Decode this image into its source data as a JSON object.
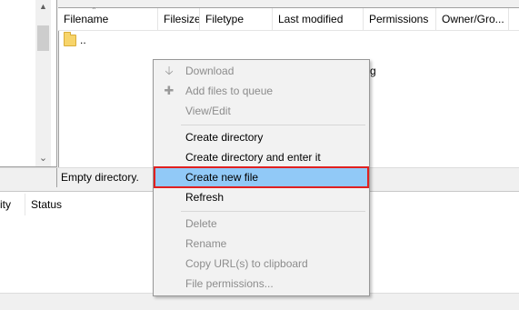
{
  "file_list": {
    "columns": [
      "Filename",
      "Filesize",
      "Filetype",
      "Last modified",
      "Permissions",
      "Owner/Gro..."
    ],
    "rows": [
      {
        "name": ".."
      }
    ],
    "partial_text": "g"
  },
  "status_bar": {
    "text": "Empty directory."
  },
  "queue": {
    "columns": [
      "ity",
      "Status"
    ]
  },
  "context_menu": {
    "items": [
      {
        "label": "Download",
        "icon": "download-arrow-icon",
        "enabled": false
      },
      {
        "label": "Add files to queue",
        "icon": "add-to-queue-icon",
        "enabled": false
      },
      {
        "label": "View/Edit",
        "enabled": false
      },
      {
        "label": "Create directory",
        "enabled": true
      },
      {
        "label": "Create directory and enter it",
        "enabled": true
      },
      {
        "label": "Create new file",
        "enabled": true,
        "highlighted": true
      },
      {
        "label": "Refresh",
        "enabled": true
      },
      {
        "label": "Delete",
        "enabled": false
      },
      {
        "label": "Rename",
        "enabled": false
      },
      {
        "label": "Copy URL(s) to clipboard",
        "enabled": false
      },
      {
        "label": "File permissions...",
        "enabled": false
      }
    ]
  },
  "colors": {
    "highlight": "#91c9f7",
    "highlight_border": "#e02020",
    "disabled_text": "#8c8c8c"
  }
}
